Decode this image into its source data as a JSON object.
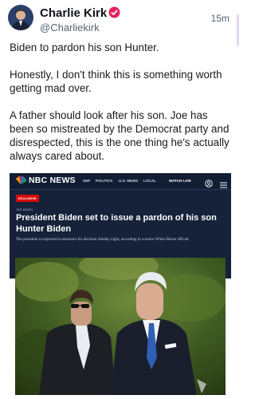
{
  "author": {
    "name": "Charlie Kirk",
    "handle": "@Charliekirk",
    "time": "15m"
  },
  "tweet": {
    "paragraphs": [
      "Biden to pardon his son Hunter.",
      "Honestly, I don't think this is something worth getting mad over.",
      "A father should look after his son. Joe has been so mistreated by the Democrat party and disrespected, this is the one thing he's actually always cared about."
    ]
  },
  "card": {
    "logo_text": "NBC NEWS",
    "nav": [
      "SNF",
      "POLITICS",
      "U.S. NEWS",
      "LOCAL"
    ],
    "live": "WATCH LIVE",
    "badge": "EXCLUSIVE",
    "kicker": "JOE BIDEN",
    "headline": "President Biden set to issue a pardon of his son Hunter Biden",
    "dek": "The president is expected to announce his decision Sunday night, according to a senior White House official."
  },
  "colors": {
    "verified": "#e0245e",
    "nbc_bg": "#16223a",
    "badge": "#d60a0a"
  },
  "icons": [
    "verified-badge-icon",
    "nbc-peacock-icon",
    "user-icon",
    "menu-icon"
  ]
}
